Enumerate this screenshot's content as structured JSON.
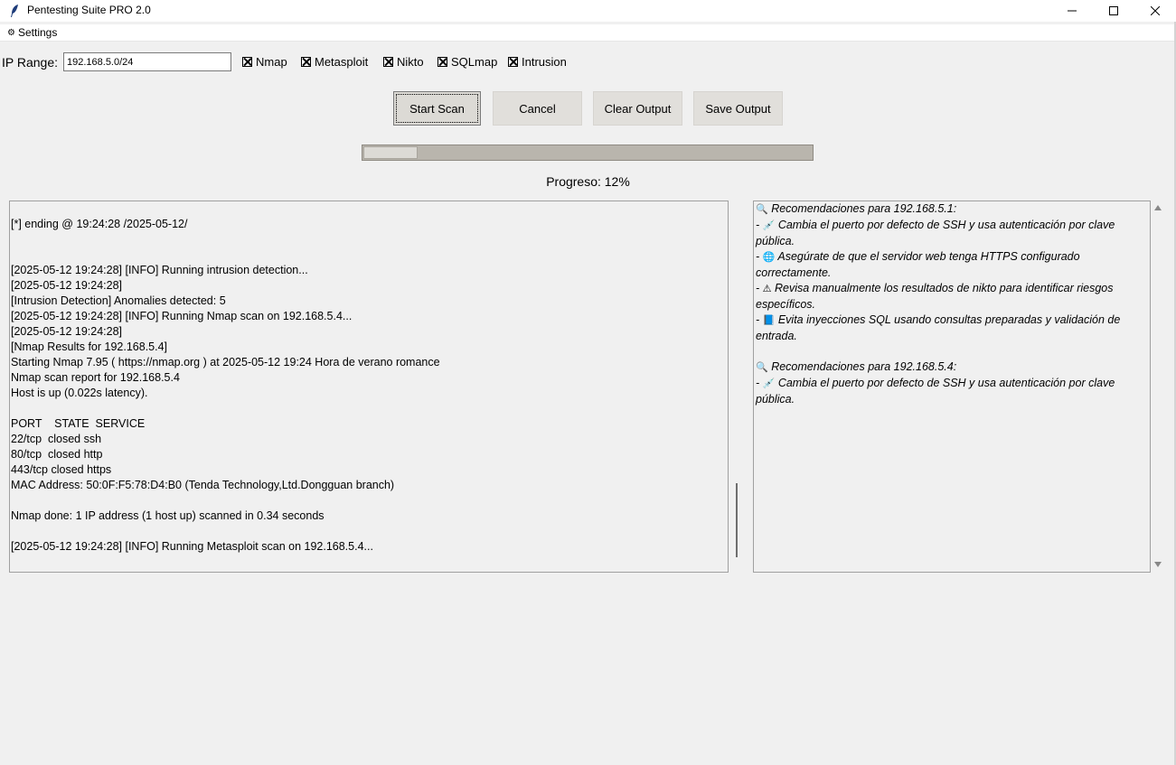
{
  "window": {
    "title": "Pentesting Suite PRO 2.0"
  },
  "menu": {
    "settings_label": "Settings",
    "settings_icon": "gear-icon"
  },
  "scan_form": {
    "ip_label": "IP Range:",
    "ip_value": "192.168.5.0/24",
    "checkboxes": [
      {
        "label": "Nmap",
        "checked": true
      },
      {
        "label": "Metasploit",
        "checked": true
      },
      {
        "label": "Nikto",
        "checked": true
      },
      {
        "label": "SQLmap",
        "checked": true
      },
      {
        "label": "Intrusion",
        "checked": true
      }
    ]
  },
  "buttons": {
    "start": "Start Scan",
    "cancel": "Cancel",
    "clear": "Clear Output",
    "save": "Save Output"
  },
  "progress": {
    "value_percent": 12,
    "label": "Progreso: 12%"
  },
  "output_lines": [
    "",
    "[*] ending @ 19:24:28 /2025-05-12/",
    "",
    "",
    "[2025-05-12 19:24:28] [INFO] Running intrusion detection...",
    "[2025-05-12 19:24:28]",
    "[Intrusion Detection] Anomalies detected: 5",
    "[2025-05-12 19:24:28] [INFO] Running Nmap scan on 192.168.5.4...",
    "[2025-05-12 19:24:28]",
    "[Nmap Results for 192.168.5.4]",
    "Starting Nmap 7.95 ( https://nmap.org ) at 2025-05-12 19:24 Hora de verano romance",
    "Nmap scan report for 192.168.5.4",
    "Host is up (0.022s latency).",
    "",
    "PORT    STATE  SERVICE",
    "22/tcp  closed ssh",
    "80/tcp  closed http",
    "443/tcp closed https",
    "MAC Address: 50:0F:F5:78:D4:B0 (Tenda Technology,Ltd.Dongguan branch)",
    "",
    "Nmap done: 1 IP address (1 host up) scanned in 0.34 seconds",
    "",
    "[2025-05-12 19:24:28] [INFO] Running Metasploit scan on 192.168.5.4..."
  ],
  "recommendations": [
    {
      "type": "header",
      "icon": "magnifier-icon",
      "text": "Recomendaciones para 192.168.5.1:"
    },
    {
      "type": "item",
      "icon": "syringe-icon",
      "text": "Cambia el puerto por defecto de SSH y usa autenticación por clave pública."
    },
    {
      "type": "item",
      "icon": "globe-icon",
      "text": "Asegúrate de que el servidor web tenga HTTPS configurado correctamente."
    },
    {
      "type": "item",
      "icon": "warning-icon",
      "text": "Revisa manualmente los resultados de nikto para identificar riesgos específicos."
    },
    {
      "type": "item",
      "icon": "book-icon",
      "text": "Evita inyecciones SQL usando consultas preparadas y validación de entrada."
    },
    {
      "type": "gap"
    },
    {
      "type": "header",
      "icon": "magnifier-icon",
      "text": "Recomendaciones para 192.168.5.4:"
    },
    {
      "type": "item",
      "icon": "syringe-icon",
      "text": "Cambia el puerto por defecto de SSH y usa autenticación por clave pública."
    }
  ]
}
